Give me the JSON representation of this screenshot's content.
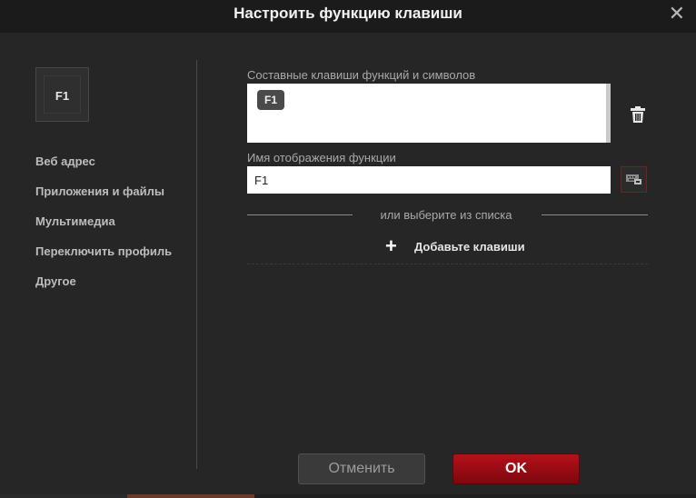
{
  "window": {
    "title": "Настроить функцию клавиши",
    "close_glyph": "✕"
  },
  "key_preview": {
    "label": "F1"
  },
  "menu": {
    "items": [
      {
        "label": "Веб адрес"
      },
      {
        "label": "Приложения и файлы"
      },
      {
        "label": "Мультимедиа"
      },
      {
        "label": "Переключить профиль"
      },
      {
        "label": "Другое"
      }
    ]
  },
  "combo": {
    "label": "Составные клавиши функций и символов",
    "keys": [
      "F1"
    ],
    "delete_icon": "trash-icon"
  },
  "display_name": {
    "label": "Имя отображения функции",
    "value": "F1",
    "keyboard_icon": "keyboard-icon"
  },
  "separator_text": "или выберите из списка",
  "add_keys": {
    "icon": "plus-icon",
    "label": "Добавьте клавиши"
  },
  "buttons": {
    "cancel": "Отменить",
    "ok": "OK"
  },
  "colors": {
    "accent": "#b5111b",
    "background": "#262627",
    "titlebar": "#1b1b1c"
  }
}
